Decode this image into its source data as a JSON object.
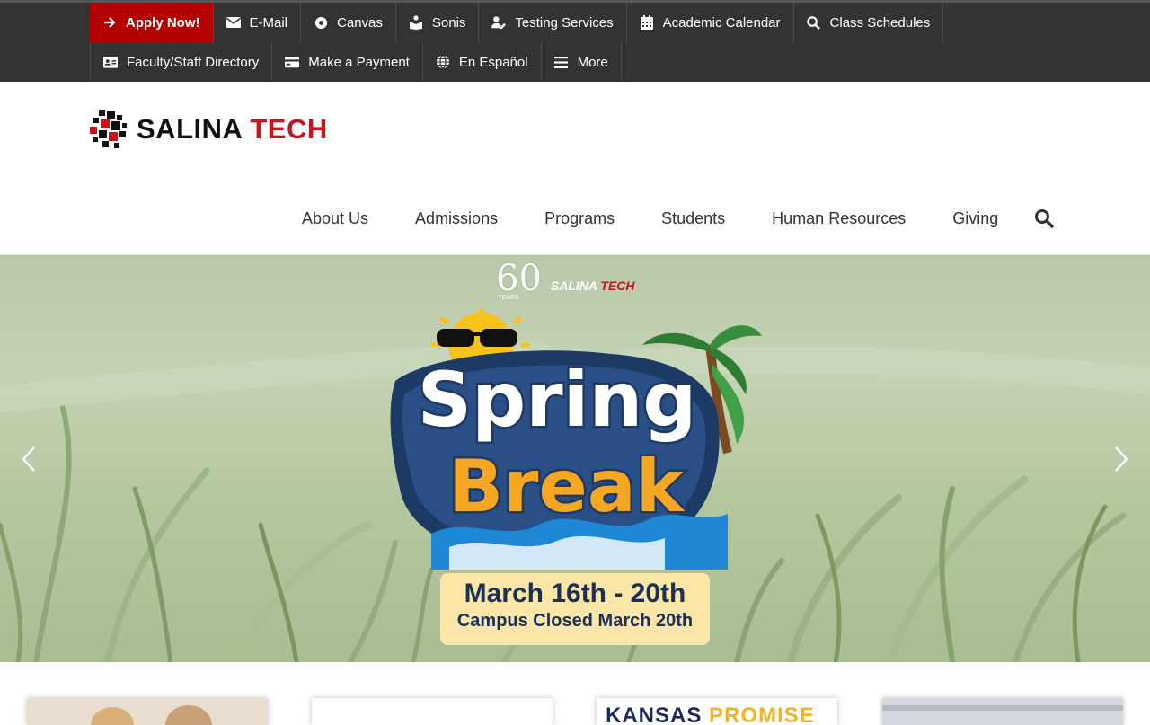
{
  "utility_bar": {
    "row1": [
      {
        "label": "Apply Now!",
        "icon": "arrow-right-icon"
      },
      {
        "label": "E-Mail",
        "icon": "envelope-icon"
      },
      {
        "label": "Canvas",
        "icon": "canvas-icon"
      },
      {
        "label": "Sonis",
        "icon": "book-reader-icon"
      },
      {
        "label": "Testing Services",
        "icon": "user-edit-icon"
      },
      {
        "label": "Academic Calendar",
        "icon": "calendar-icon"
      },
      {
        "label": "Class Schedules",
        "icon": "search-icon"
      }
    ],
    "row2": [
      {
        "label": "Faculty/Staff Directory",
        "icon": "id-card-icon"
      },
      {
        "label": "Make a Payment",
        "icon": "credit-card-icon"
      },
      {
        "label": "En Español",
        "icon": "globe-icon"
      },
      {
        "label": "More",
        "icon": "bars-icon"
      }
    ]
  },
  "logo": {
    "part1": "SALINA",
    "part2": "TECH"
  },
  "main_nav": [
    "About Us",
    "Admissions",
    "Programs",
    "Students",
    "Human Resources",
    "Giving"
  ],
  "hero": {
    "badge": {
      "number": "60",
      "years": "YEARS",
      "brand1": "SALINA",
      "brand2": "TECH"
    },
    "headline1": "Spring",
    "headline2": "Break",
    "dates": "March 16th - 20th",
    "closed": "Campus Closed March 20th"
  },
  "cards": {
    "kansas_word": "KANSAS",
    "promise_word": "PROMISE"
  },
  "colors": {
    "brand_red": "#c4161c",
    "apply_red": "#b30000",
    "utility_bg": "#333333",
    "navy": "#1a3057",
    "cream": "#fbe5a7"
  }
}
